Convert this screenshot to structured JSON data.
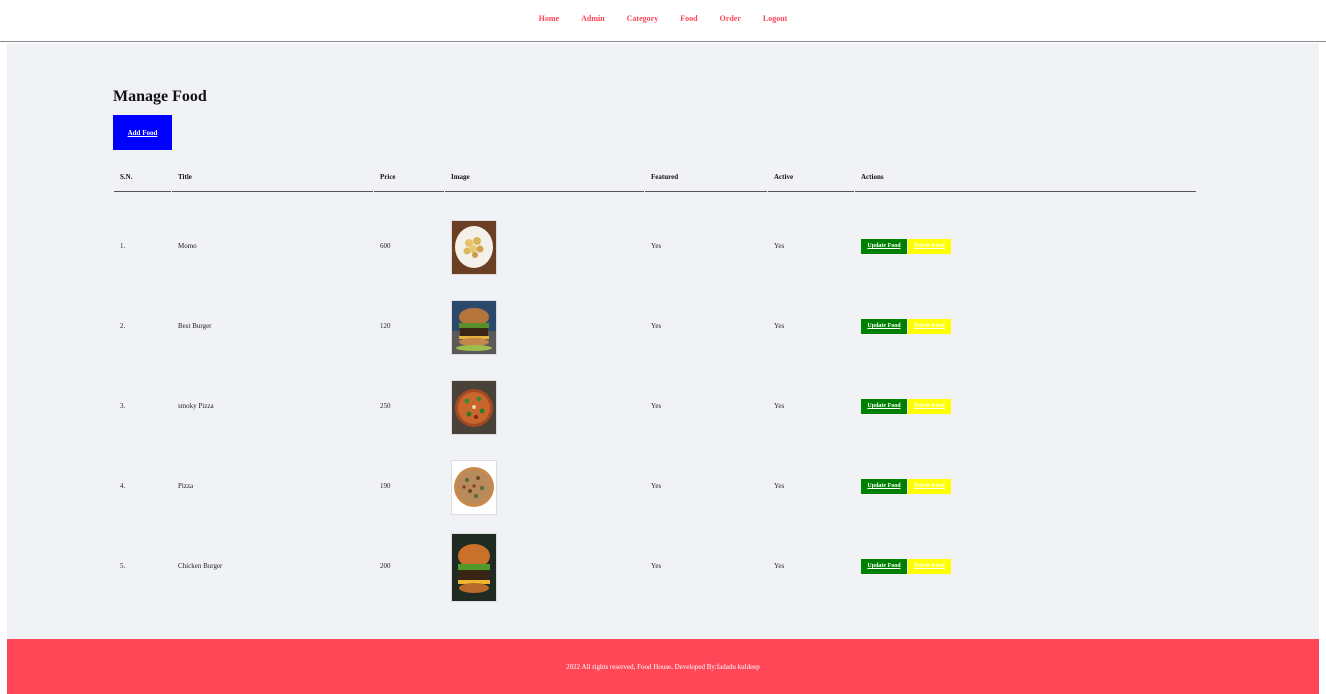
{
  "nav": {
    "items": [
      {
        "label": "Home"
      },
      {
        "label": "Admin"
      },
      {
        "label": "Category"
      },
      {
        "label": "Food"
      },
      {
        "label": "Order"
      },
      {
        "label": "Logout"
      }
    ]
  },
  "main": {
    "title": "Manage Food",
    "add_button": "Add Food",
    "columns": [
      "S.N.",
      "Title",
      "Price",
      "Image",
      "Featured",
      "Active",
      "Actions"
    ],
    "rows": [
      {
        "sn": "1.",
        "title": "Momo",
        "price": "600",
        "featured": "Yes",
        "active": "Yes",
        "image": "momo-photo"
      },
      {
        "sn": "2.",
        "title": "Best Burger",
        "price": "120",
        "featured": "Yes",
        "active": "Yes",
        "image": "burger-photo"
      },
      {
        "sn": "3.",
        "title": "smoky Pizza",
        "price": "250",
        "featured": "Yes",
        "active": "Yes",
        "image": "smoky-pizza-photo"
      },
      {
        "sn": "4.",
        "title": "Pizza",
        "price": "190",
        "featured": "Yes",
        "active": "Yes",
        "image": "pizza-photo"
      },
      {
        "sn": "5.",
        "title": "Chicken Burger",
        "price": "200",
        "featured": "Yes",
        "active": "Yes",
        "image": "chicken-burger-photo"
      }
    ],
    "update_label": "Update Food",
    "delete_label": "Delete Food"
  },
  "footer": {
    "text": "2022 All rights reserved, Food House. Developed By:fadadu kuldeep"
  },
  "colors": {
    "nav_link": "#ff4757",
    "footer_bg": "#ff4757",
    "content_bg": "#f1f2f6",
    "add_button": "#0000ff",
    "update_button": "#008000",
    "delete_button": "#ffff00"
  }
}
